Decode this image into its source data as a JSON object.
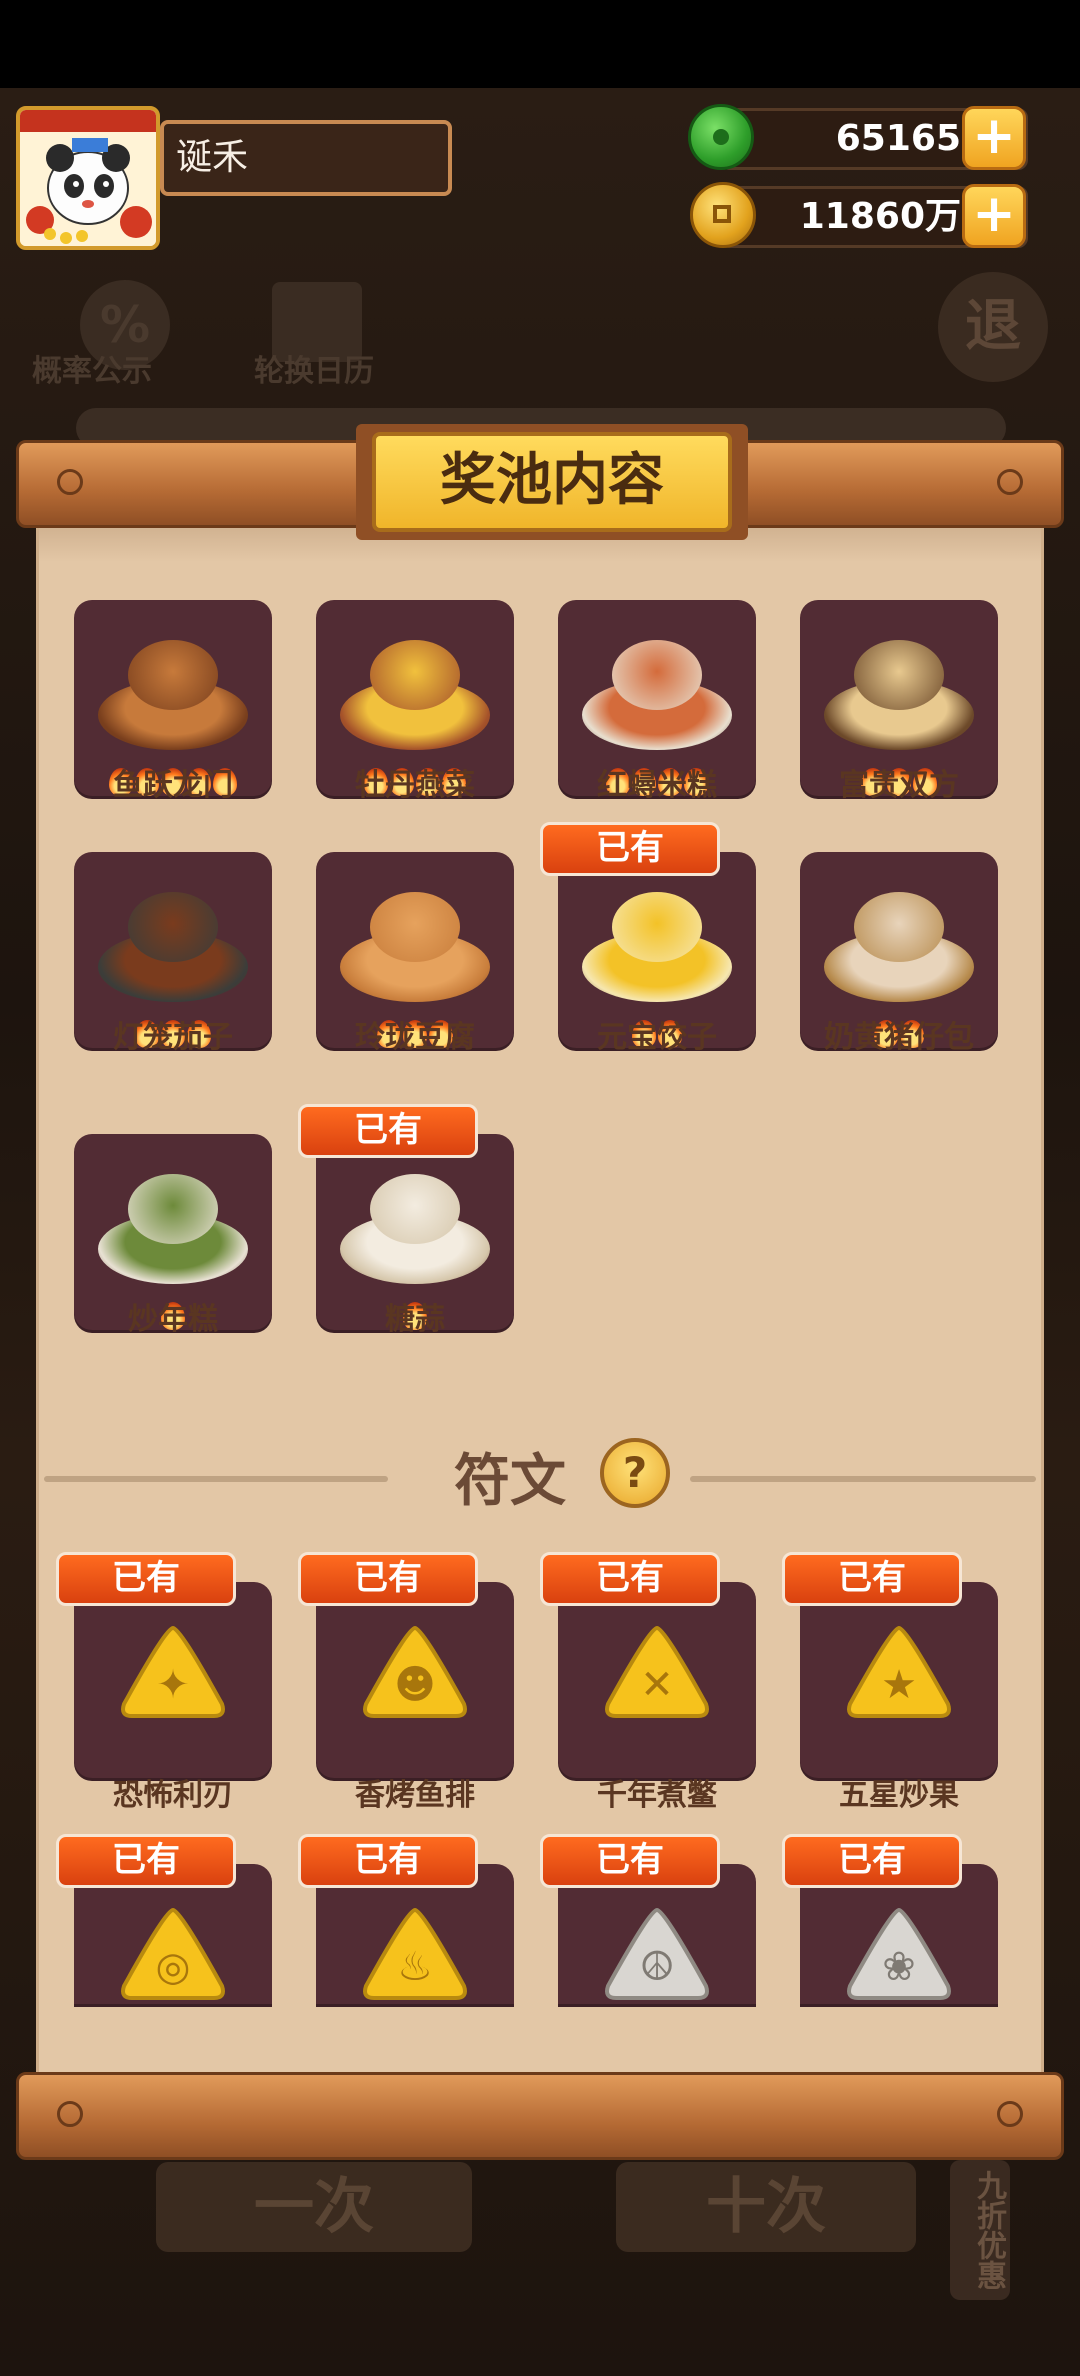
{
  "player": {
    "name": "诞禾"
  },
  "currency": {
    "gems": "65165",
    "coins": "11860万",
    "plus": "+"
  },
  "background": {
    "probability_label": "概率公示",
    "calendar_label": "轮换日历",
    "exit_label": "退",
    "single_draw": "一次",
    "ten_draw": "十次",
    "discount": "九折优惠"
  },
  "panel": {
    "title": "奖池内容"
  },
  "dishes": [
    {
      "name": "鱼跃龙门",
      "stars": 5,
      "owned": false
    },
    {
      "name": "牡丹燕菜",
      "stars": 4,
      "owned": false
    },
    {
      "name": "红蟳米糕",
      "stars": 4,
      "owned": false
    },
    {
      "name": "富贵双方",
      "stars": 3,
      "owned": false
    },
    {
      "name": "灯笼茄子",
      "stars": 3,
      "owned": false
    },
    {
      "name": "玲珑豆腐",
      "stars": 3,
      "owned": false
    },
    {
      "name": "元宝饺子",
      "stars": 2,
      "owned": true
    },
    {
      "name": "奶黄猪仔包",
      "stars": 2,
      "owned": false
    },
    {
      "name": "炒年糕",
      "stars": 1,
      "owned": false
    },
    {
      "name": "糖蒜",
      "stars": 1,
      "owned": true
    }
  ],
  "rune_section": {
    "title": "符文",
    "help": "?"
  },
  "runes": [
    {
      "name": "恐怖利刃",
      "owned": true,
      "color": "#f6c21c"
    },
    {
      "name": "香烤鱼排",
      "owned": true,
      "color": "#f6c21c"
    },
    {
      "name": "千年煮鳖",
      "owned": true,
      "color": "#f6c21c"
    },
    {
      "name": "五星炒果",
      "owned": true,
      "color": "#f6c21c"
    },
    {
      "name": "",
      "owned": true,
      "color": "#f6c21c"
    },
    {
      "name": "",
      "owned": true,
      "color": "#f6c21c"
    },
    {
      "name": "",
      "owned": true,
      "color": "#d9d6d1"
    },
    {
      "name": "",
      "owned": true,
      "color": "#d9d6d1"
    }
  ],
  "owned_label": "已有"
}
